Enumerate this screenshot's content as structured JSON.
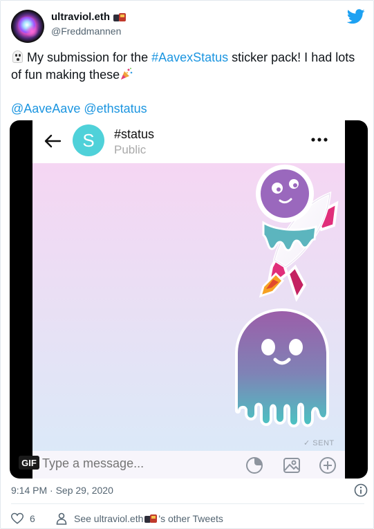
{
  "user": {
    "display_name": "ultraviol.eth",
    "handle": "@Freddmannen",
    "name_emoji": "train-icon"
  },
  "tweet": {
    "text_before": "My submission for the ",
    "hashtag": "#AavexStatus",
    "text_after": " sticker pack! I had lots of fun making these",
    "mention1": "@AaveAave",
    "mention2": "@ethstatus",
    "timestamp": "9:14 PM · Sep 29, 2020"
  },
  "media": {
    "chat_title": "#status",
    "chat_subtitle": "Public",
    "chat_avatar_letter": "S",
    "sent_label": "✓ SENT",
    "gif_badge": "GIF",
    "message_placeholder": "Type a message..."
  },
  "footer": {
    "like_count": "6",
    "see_prefix": "See ultraviol.eth",
    "see_suffix": "'s other Tweets"
  },
  "colors": {
    "link": "#1b95e0",
    "twitter_blue": "#1da1f2",
    "status_teal": "#4fd1d9"
  }
}
